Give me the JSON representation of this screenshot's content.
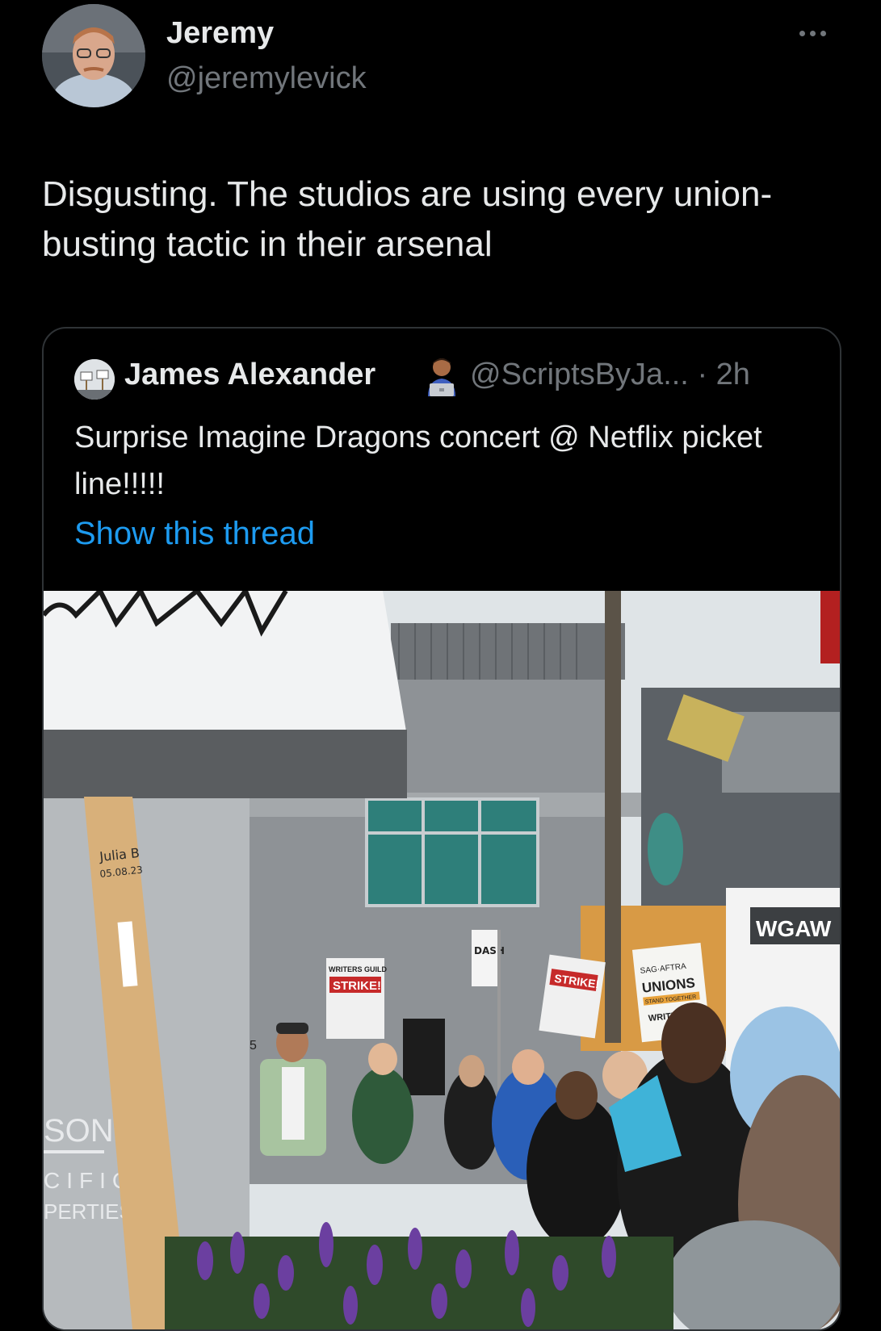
{
  "tweet": {
    "author_name": "Jeremy",
    "author_handle": "@jeremylevick",
    "text": "Disgusting. The studios are using every union-busting tactic in their arsenal"
  },
  "quoted_tweet": {
    "author_name": "James Alexander",
    "author_emoji": "technologist-emoji",
    "author_handle": "@ScriptsByJa...",
    "time": "· 2h",
    "text": "Surprise Imagine Dragons concert @ Netflix picket line!!!!!",
    "link_label": "Show this thread",
    "link_color": "#1d9bf0"
  },
  "photo": {
    "description_alt": "photo",
    "sign_writers_guild": "WRITERS GUILD",
    "sign_strike": "STRIKE!",
    "sign_wgaw": "WGAW",
    "sign_sag": "SAG·AFTRA",
    "sign_unions": "UNIONS",
    "sign_stand": "STAND TOGETHER",
    "sign_writers": "WRITERS",
    "sign_dash": "DASH",
    "stick_name": "Julia B",
    "stick_date": "05.08.23",
    "wall_text_1": "SON",
    "wall_text_2": "CIFIC",
    "wall_text_3": "PERTIES",
    "building_number": "5"
  },
  "colors": {
    "background": "#000000",
    "text_primary": "#e7e9ea",
    "text_secondary": "#71767b",
    "border": "#2f3336"
  }
}
